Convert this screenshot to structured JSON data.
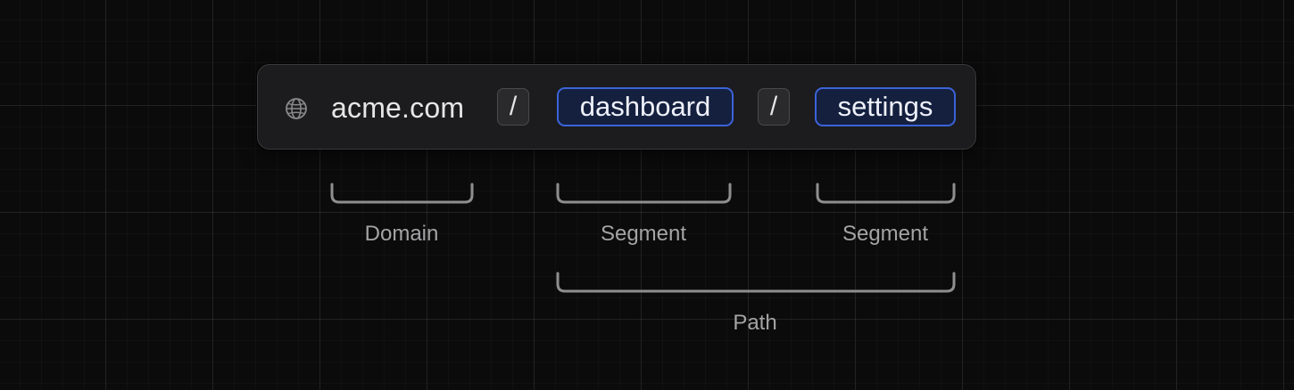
{
  "url": {
    "globe_icon": "globe-icon",
    "domain": "acme.com",
    "separator": "/",
    "segments": [
      "dashboard",
      "settings"
    ]
  },
  "annotations": {
    "domain": "Domain",
    "segment_1": "Segment",
    "segment_2": "Segment",
    "path": "Path"
  },
  "colors": {
    "background": "#0b0b0b",
    "bar": "#1c1c1e",
    "segment_border": "#3b63d8",
    "label": "#a4a4a6"
  }
}
